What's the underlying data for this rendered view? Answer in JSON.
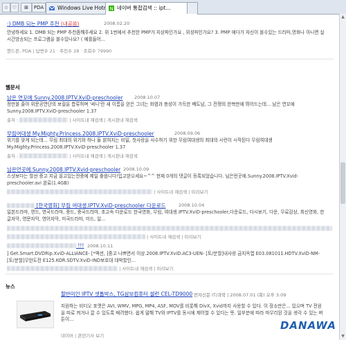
{
  "browser": {
    "toolbar_buttons": [
      "☆",
      "♡",
      "⊞",
      "PDA"
    ],
    "tabs": [
      {
        "label": "Windows Live Hotmail",
        "active": false
      },
      {
        "label": "네이버 통합검색 :: ipt...",
        "active": true
      }
    ]
  },
  "qna": {
    "title_prefix": ":) DMB 되는 PMP 추천 ",
    "title_em": "(내공쏨)",
    "date": "2008.02.20",
    "body": "안녕하세요 1. DMB 되는 PMP 추천좀해주세요 2. 위 1번에서 추천한 PMP가 지상파인가요 , 위성파인가요? 3. PMP 에다가 자신이 볼수있는 드라마,영화나 아니면 실시간방송되는 프로그램을 볼수있나요? ( 예를들어...",
    "meta": "핸드폰, PDA | 답변수 21 · 추천수 28 · 조회수 79990"
  },
  "documents": {
    "heading": "웹문서",
    "items": [
      {
        "title": "남은 연꼬에 Sunny.2008.IPTV.XviD-preschooler",
        "date": "2008.10.07",
        "body": "정만볼 줄아 위문공연단의 보컬을 합류하며 '써니'란 새 이름을 얻은 그녀는 화염과 총성이 가득한 베트남, 그 전쟁의 한복판에 뛰어드는데... 남은 연꼬에 Sunny.2008.IPTV.XviD-preschooler 1.37",
        "meta_prefix": "출처 :",
        "meta_links": [
          "사이트내 재검색",
          "게시판내 재검색"
        ]
      },
      {
        "title": "무림여대생 My.Mighty.Princess.2008.IPTV.XviD-preschooler",
        "date": "2008.09.06",
        "body": "위기를 맞게 되는데... 무림 최대의 위기와 하나 둘 밝혀지는 비밀, 첫사랑을 사수하기 위한 무림여대생의 최대의 시련이 시작된다 무림여대생 My.Mighty.Princess.2008.IPTV.XviD-preschooler 1.37",
        "meta_prefix": "출처 :",
        "meta_links": [
          "사이트내 재검색",
          "게시판내 재검색"
        ]
      },
      {
        "title": "님은먼곳에.Sunny.2008.IPTV.Xvid-preschooler",
        "date": "2008.10.09",
        "body": "스샷보다는 할선 중고 지금 올고있는전중에 제일 좋음니다!입고받으세요~^^ 현재 0개의 댓글이 등록되었습니다. 님은먼곳에.Sunny.2008.IPTV.Xvid-preschooler.avi 완료(1.4GB)",
        "meta_prefix": "",
        "meta_links": [
          "사이트내 재검색",
          "미리보기"
        ]
      },
      {
        "title": "[한국영화] 무림 여대생.IPTV.XviD-preschooler 다운로드",
        "date": "2008.10.04",
        "body": "일본드라마, 영드, 영국드라마, 중드, 중국드라마, 초고속 다운로드 한국영화, 무림, 여대생.IPTV.XviD-preschooler,다운로드, 다시보기, 다운, 무료감상, 최신영화, 한글자막, 영문자막, 영어자막, 미국드라마, 미드, 일...",
        "meta_prefix": "",
        "meta_links": [
          "사이트내 재검색",
          "미리보기"
        ]
      },
      {
        "title": "!!!",
        "date": "2008.10.11",
        "body": "] Get.Smart.DVDRip.XviD-ALLIANCE- [*액션,  ]중고 나쁘면서 이상.2008.IPTV.XviD.AC3-UEN- [토/분할]내사랑 금지옥엽 E03.081011.HDTV.XviD-NM- [토/분할]무한도전 E125.KOR.SDTV.XviD-IND보호대 대박할인...",
        "meta_prefix": "",
        "meta_links": [
          "사이트내 재검색",
          "미리보기"
        ]
      }
    ]
  },
  "news": {
    "heading": "뉴스",
    "item": {
      "title": "할반미인 IPTV 셋톱박스, TG삼보컴퓨터 셀런 CEL-TD9000",
      "source": "전자신문 IT/과학",
      "date": "2008.07.01 (화) 오후 3:09",
      "body": "지원하는 비디오 포맷은 AVI, WMV, MPG, MP4, ASF, MOV를 비롯해 DivX, Xvid까지 사용할 수 있다. 이 장소만은... 있으며 TV 전원을 따로 켜거나 끌 수 있도록 배려했다. 쉽게 말해 TV와 IPTV를 동시에 제어할 수 있다는 뜻. 일부분에 따라 마무리된 것을 생각 수 있는 버튼이...",
      "meta_label": "네이버",
      "meta_link": "관련기사 보기"
    }
  },
  "watermark": {
    "main": "DANAWA",
    "accent": "A"
  }
}
